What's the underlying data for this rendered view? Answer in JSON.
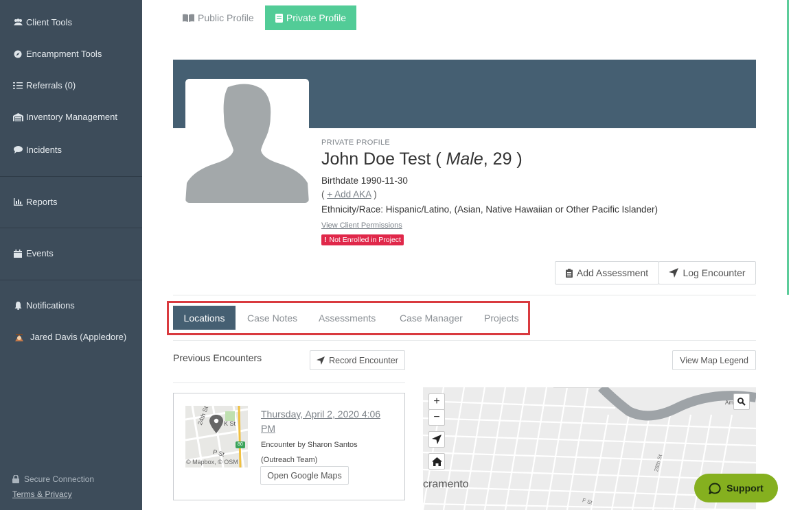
{
  "sidebar": {
    "items": [
      {
        "label": "Client Tools",
        "icon": "users-icon"
      },
      {
        "label": "Encampment Tools",
        "icon": "compass-icon"
      },
      {
        "label": "Referrals (0)",
        "icon": "checklist-icon"
      },
      {
        "label": "Inventory Management",
        "icon": "warehouse-icon"
      },
      {
        "label": "Incidents",
        "icon": "comment-icon"
      },
      {
        "label": "Reports",
        "icon": "bar-chart-icon"
      },
      {
        "label": "Events",
        "icon": "calendar-icon"
      },
      {
        "label": "Notifications",
        "icon": "bell-icon"
      },
      {
        "label": "Jared Davis (Appledore)",
        "icon": "user-avatar-icon"
      }
    ],
    "secure": "Secure Connection",
    "terms": "Terms & Privacy"
  },
  "profile_tabs": {
    "public": "Public Profile",
    "private": "Private Profile"
  },
  "profile": {
    "label": "PRIVATE PROFILE",
    "name": "John Doe Test (",
    "gender": "Male",
    "age_suffix": ", 29 )",
    "birthdate": "Birthdate 1990-11-30",
    "aka_open": "(",
    "aka_link": "+ Add AKA",
    "aka_close": ")",
    "ethnicity": "Ethnicity/Race: Hispanic/Latino, (Asian, Native Hawaiian or Other Pacific Islander)",
    "permissions_link": "View Client Permissions",
    "badge": "Not Enrolled in Project",
    "badge_mark": "!"
  },
  "actions": {
    "add_assessment": "Add Assessment",
    "log_encounter": "Log Encounter"
  },
  "section_tabs": [
    "Locations",
    "Case Notes",
    "Assessments",
    "Case Manager",
    "Projects"
  ],
  "encounters": {
    "title": "Previous Encounters",
    "record_button": "Record Encounter",
    "legend_button": "View Map Legend",
    "item": {
      "date": "Thursday, April 2, 2020 4:06 PM",
      "by": "Encounter by Sharon Santos (Outreach Team)",
      "gmaps_button": "Open Google Maps",
      "thumb_labels": [
        "24th St",
        "K St",
        "P St",
        "80"
      ],
      "attribution": "© Mapbox, © OSM"
    }
  },
  "map": {
    "zoom_in": "+",
    "zoom_out": "−",
    "city_label": "cramento",
    "street_labels": [
      "28th St",
      "F St",
      "Am"
    ]
  },
  "support": "Support",
  "colors": {
    "sidebar": "#3d4c5a",
    "banner": "#455f72",
    "accent_green": "#52cc97",
    "badge_red": "#e0284a",
    "highlight_outline": "#d93a3f",
    "support": "#85b01f"
  }
}
